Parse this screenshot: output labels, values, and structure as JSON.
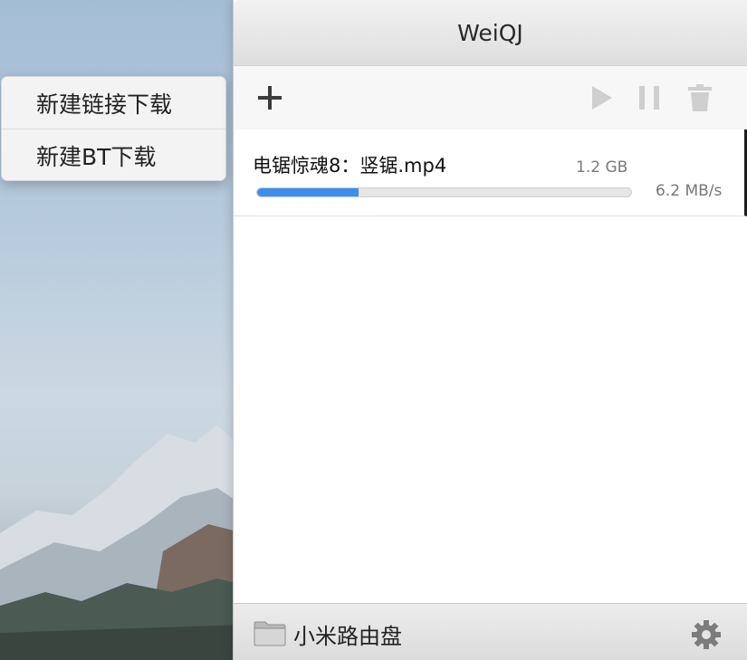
{
  "context_menu": {
    "items": [
      {
        "label": "新建链接下载"
      },
      {
        "label": "新建BT下载"
      }
    ]
  },
  "window": {
    "title": "WeiQJ"
  },
  "toolbar": {
    "add_icon": "plus-icon",
    "play_icon": "play-icon",
    "pause_icon": "pause-icon",
    "delete_icon": "trash-icon"
  },
  "downloads": [
    {
      "name": "电锯惊魂8：竖锯.mp4",
      "size": "1.2 GB",
      "speed": "6.2 MB/s",
      "progress": 0.27
    }
  ],
  "footer": {
    "folder_icon": "folder-icon",
    "location": "小米路由盘",
    "settings_icon": "gear-icon"
  },
  "colors": {
    "progress": "#3b8ff0",
    "disabled_icon": "#cfcfcf"
  }
}
